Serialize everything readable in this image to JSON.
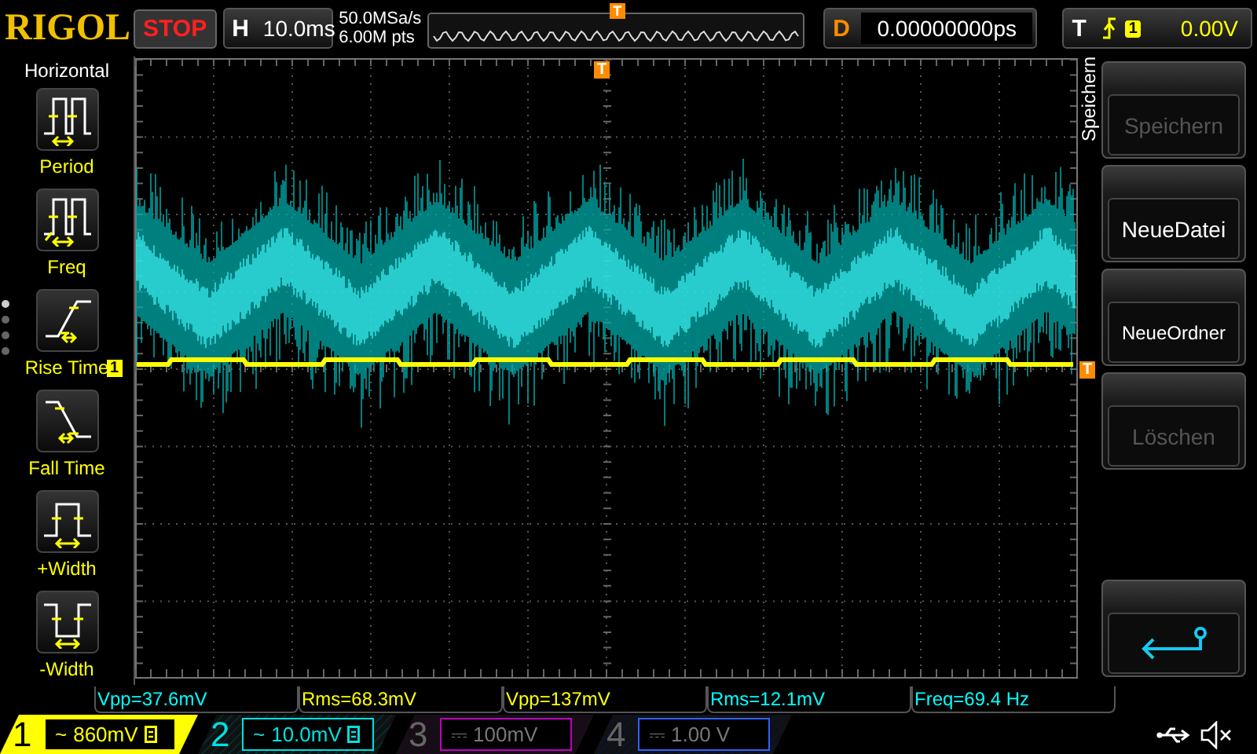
{
  "header": {
    "logo": "RIGOL",
    "run_state": "STOP",
    "timebase_label": "H",
    "timebase": "10.0ms",
    "sample_rate": "50.0MSa/s",
    "memory_depth": "6.00M pts",
    "overview_marker": "T",
    "delay_label": "D",
    "delay": "0.00000000ps",
    "trigger_label": "T",
    "trigger_source": "1",
    "trigger_level": "0.00V"
  },
  "left_menu": {
    "title": "Horizontal",
    "items": [
      {
        "label": "Period",
        "kind": "period"
      },
      {
        "label": "Freq",
        "kind": "freq"
      },
      {
        "label": "Rise Time",
        "kind": "rise"
      },
      {
        "label": "Fall Time",
        "kind": "fall"
      },
      {
        "label": "+Width",
        "kind": "pwidth"
      },
      {
        "label": "-Width",
        "kind": "nwidth"
      }
    ],
    "pages": [
      {
        "selected": true
      },
      {
        "selected": false
      },
      {
        "selected": false
      },
      {
        "selected": false
      }
    ]
  },
  "display": {
    "trigger_position_marker": "T",
    "channel_marker": "1",
    "trigger_level_marker": "T"
  },
  "right_menu": {
    "title": "Speichern",
    "items": [
      {
        "kind": "text",
        "label": "Speichern",
        "disabled": true
      },
      {
        "kind": "text",
        "label": "NeueDatei",
        "disabled": false
      },
      {
        "kind": "text",
        "label": "NeueOrdner",
        "disabled": false
      },
      {
        "kind": "text",
        "label": "Löschen",
        "disabled": true
      },
      {
        "kind": "empty"
      },
      {
        "kind": "back"
      }
    ]
  },
  "measurements": [
    {
      "text": "Vpp=37.6mV",
      "color": "#00ffff"
    },
    {
      "text": "Rms=68.3mV",
      "color": "#ffff00"
    },
    {
      "text": "Vpp=137mV",
      "color": "#ffff00"
    },
    {
      "text": "Rms=12.1mV",
      "color": "#00ffff"
    },
    {
      "text": "Freq=69.4 Hz",
      "color": "#00ffff"
    }
  ],
  "channels": [
    {
      "number": "1",
      "coupling": "~",
      "scale": "860mV",
      "on": true,
      "selected": true,
      "bw_limit": true,
      "color": "#ffff00"
    },
    {
      "number": "2",
      "coupling": "~",
      "scale": "10.0mV",
      "on": true,
      "selected": false,
      "bw_limit": true,
      "color": "#00e0e0"
    },
    {
      "number": "3",
      "coupling": "⎓",
      "scale": "100mV",
      "on": false,
      "selected": false,
      "bw_limit": false,
      "color": "#c000c0"
    },
    {
      "number": "4",
      "coupling": "⎓",
      "scale": "1.00 V",
      "on": false,
      "selected": false,
      "bw_limit": false,
      "color": "#3060ff"
    }
  ]
}
